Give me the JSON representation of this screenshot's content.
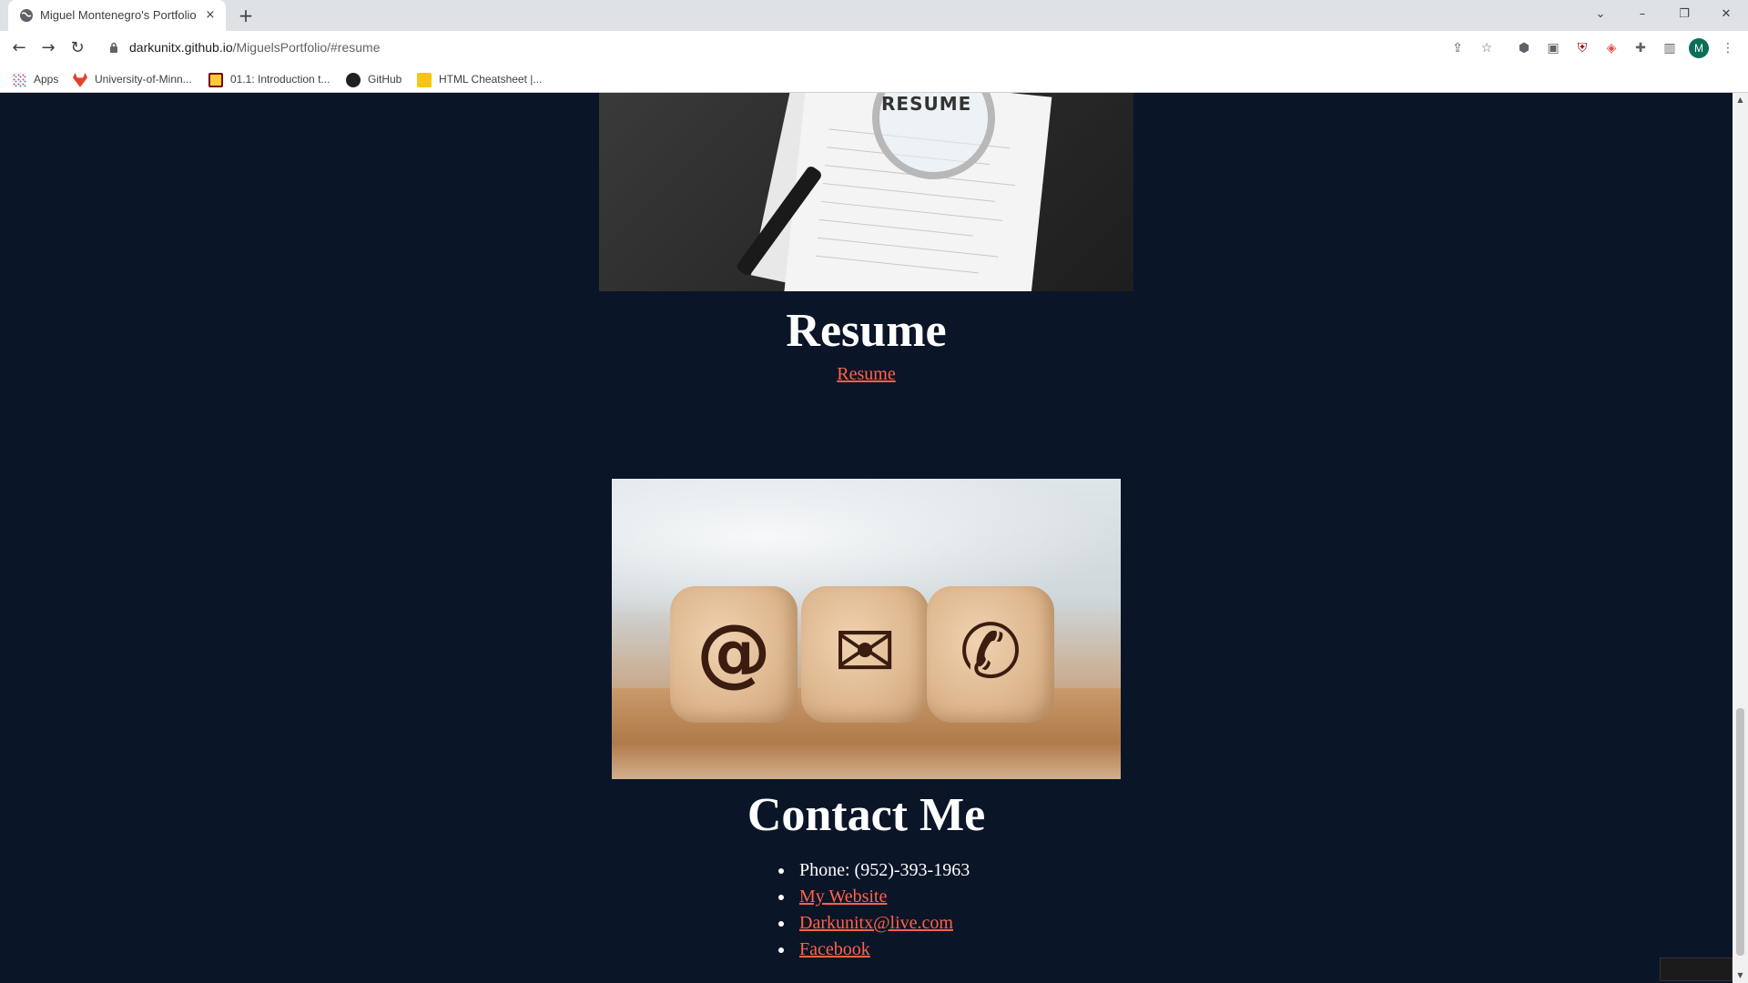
{
  "browser": {
    "tab_title": "Miguel Montenegro's Portfolio",
    "tab_close": "×",
    "new_tab": "+",
    "window_controls": {
      "chevron": "⌄",
      "minimize": "–",
      "restore": "❐",
      "close": "✕"
    },
    "url_host": "darkunitx.github.io",
    "url_path": "/MiguelsPortfolio/#resume",
    "profile_initial": "M",
    "nav": {
      "back": "←",
      "forward": "→",
      "reload": "↻"
    }
  },
  "bookmarks": [
    {
      "label": "Apps",
      "icon": "apps-grid-icon"
    },
    {
      "label": "University-of-Minn...",
      "icon": "gitlab-icon"
    },
    {
      "label": "01.1: Introduction t...",
      "icon": "umn-icon"
    },
    {
      "label": "GitHub",
      "icon": "github-icon"
    },
    {
      "label": "HTML Cheatsheet |...",
      "icon": "fs-icon"
    }
  ],
  "resume": {
    "image_text": "RESUME",
    "title": "Resume",
    "link": "Resume"
  },
  "contact": {
    "title": "Contact Me",
    "items": [
      {
        "text": "Phone: (952)-393-1963",
        "is_link": false
      },
      {
        "text": "My Website",
        "is_link": true
      },
      {
        "text": "Darkunitx@live.com",
        "is_link": true
      },
      {
        "text": "Facebook",
        "is_link": true
      }
    ],
    "cube_glyphs": [
      "@",
      "✉",
      "✆"
    ]
  },
  "colors": {
    "page_bg": "#0b1528",
    "link": "#ff6347",
    "heading": "#ffffff"
  }
}
